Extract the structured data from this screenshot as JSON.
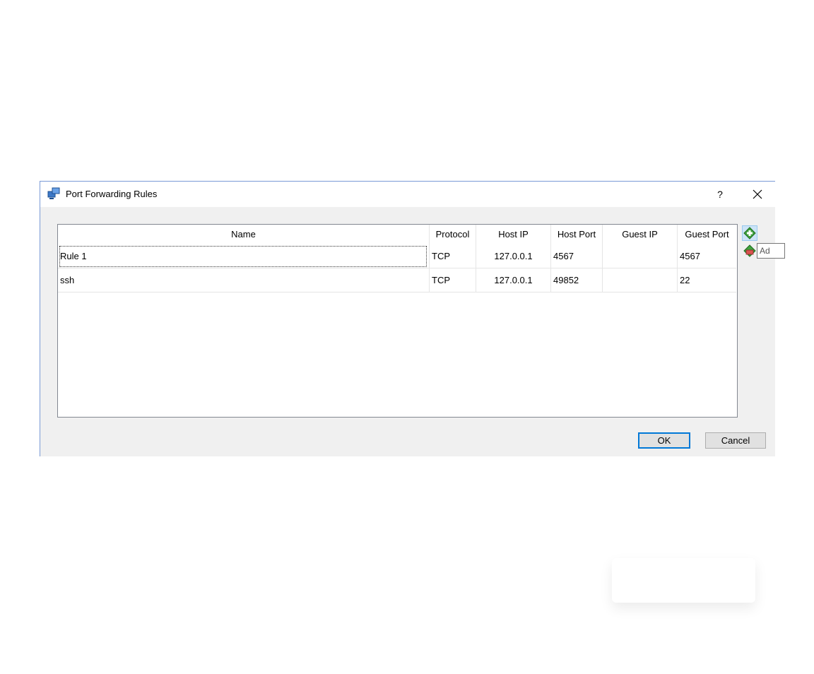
{
  "window": {
    "title": "Port Forwarding Rules",
    "help_label": "?",
    "close_label": "×"
  },
  "table": {
    "columns": [
      "Name",
      "Protocol",
      "Host IP",
      "Host Port",
      "Guest IP",
      "Guest Port"
    ],
    "rows": [
      {
        "name": "Rule 1",
        "protocol": "TCP",
        "host_ip": "127.0.0.1",
        "host_port": "4567",
        "guest_ip": "",
        "guest_port": "4567"
      },
      {
        "name": "ssh",
        "protocol": "TCP",
        "host_ip": "127.0.0.1",
        "host_port": "49852",
        "guest_ip": "",
        "guest_port": "22"
      }
    ]
  },
  "side_buttons": {
    "add_icon": "add-rule-icon",
    "remove_icon": "remove-rule-icon",
    "tooltip": "Ad"
  },
  "buttons": {
    "ok": "OK",
    "cancel": "Cancel"
  },
  "colors": {
    "dialog_bg": "#f0f0f0",
    "accent": "#0078d7",
    "icon_green": "#3fa33f"
  }
}
